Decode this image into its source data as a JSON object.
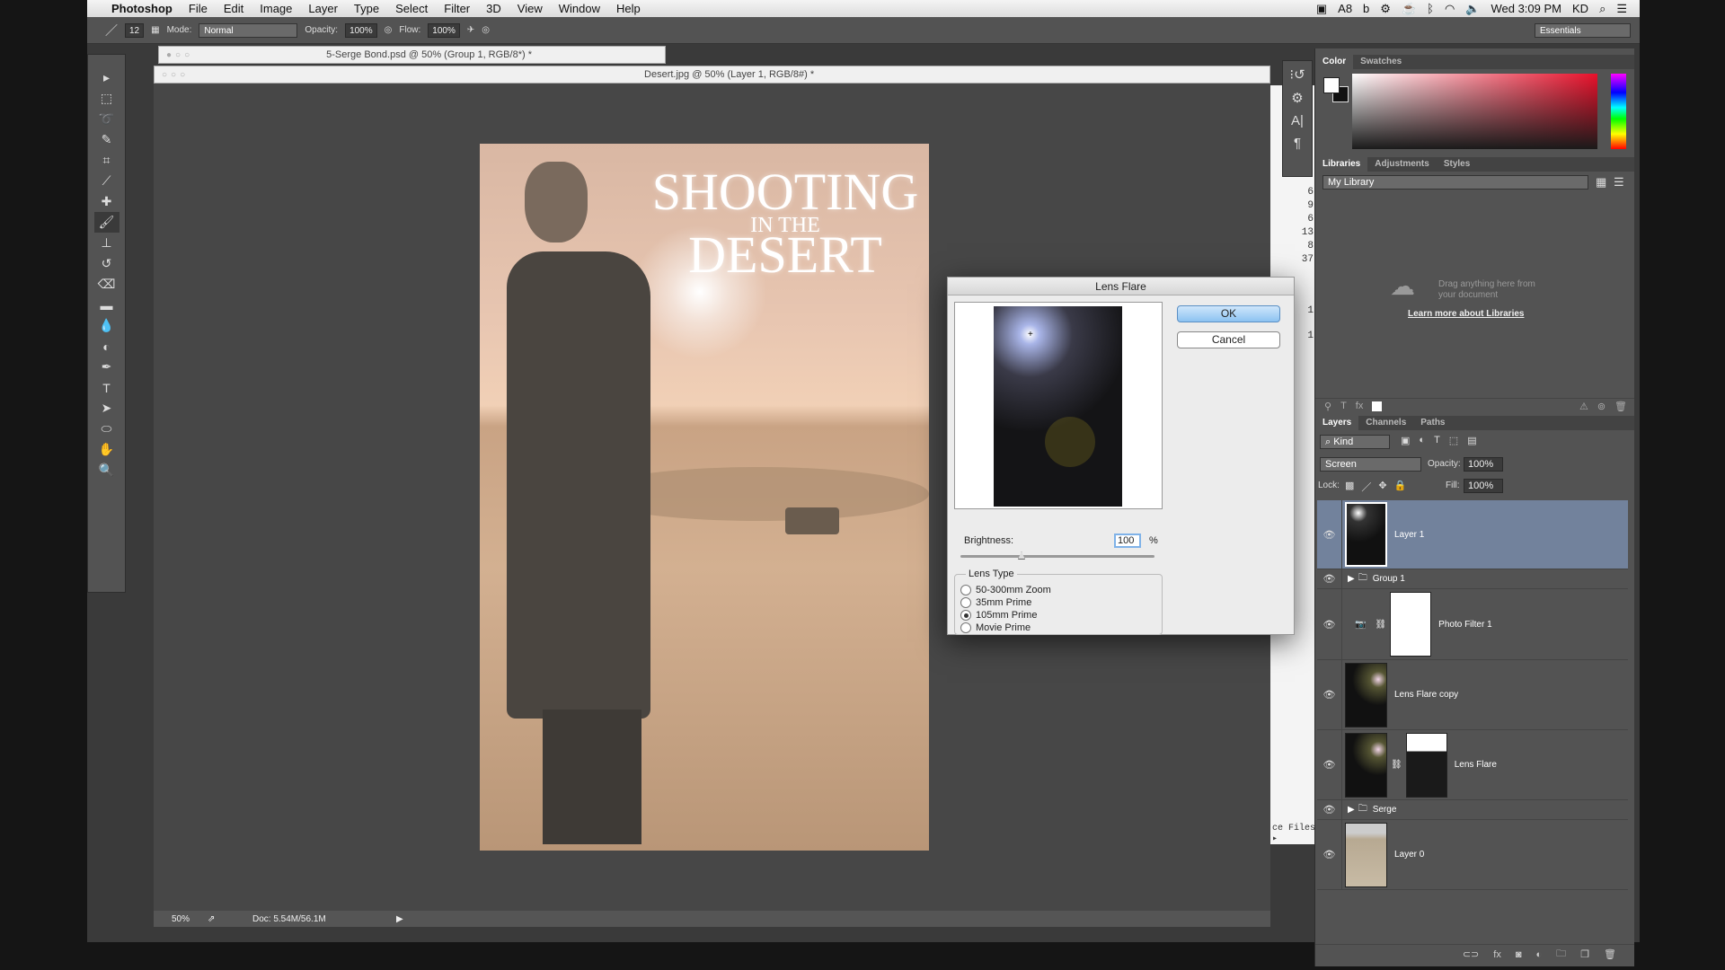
{
  "menubar": {
    "app": "Photoshop",
    "items": [
      "File",
      "Edit",
      "Image",
      "Layer",
      "Type",
      "Select",
      "Filter",
      "3D",
      "View",
      "Window",
      "Help"
    ],
    "status_icons": [
      "camera-icon",
      "adobe-icon",
      "b-icon",
      "gear-icon",
      "satellite-icon",
      "coffee-icon",
      "bluetooth-icon",
      "wifi-icon",
      "volume-icon"
    ],
    "adobe_count": "8",
    "b_label": "b",
    "clock": "Wed 3:09 PM",
    "user": "KD"
  },
  "options": {
    "brush_size": "12",
    "mode_label": "Mode:",
    "mode_value": "Normal",
    "opacity_label": "Opacity:",
    "opacity_value": "100%",
    "flow_label": "Flow:",
    "flow_value": "100%",
    "workspace": "Essentials"
  },
  "tools": [
    "move",
    "marquee",
    "lasso",
    "quick-select",
    "crop",
    "eyedropper",
    "healing",
    "brush",
    "clone-stamp",
    "history-brush",
    "eraser",
    "gradient",
    "blur",
    "dodge",
    "pen",
    "type",
    "path-select",
    "shape",
    "hand",
    "zoom"
  ],
  "tool_glyphs": [
    "▸",
    "⬚",
    "➰",
    "✎",
    "⌗",
    "⟋",
    "✚",
    "🖌",
    "⊥",
    "↺",
    "⌫",
    "▬",
    "💧",
    "◐",
    "✒",
    "T",
    "➤",
    "⬭",
    "✋",
    "🔍"
  ],
  "docs": {
    "tab1": "5-Serge Bond.psd @ 50% (Group 1, RGB/8*) *",
    "tab2": "Desert.jpg @ 50% (Layer 1, RGB/8#) *"
  },
  "poster": {
    "line1": "SHOOTING",
    "line2": "IN THE",
    "line3": "DESERT"
  },
  "status": {
    "zoom": "50%",
    "doc": "Doc: 5.54M/56.1M"
  },
  "dialog": {
    "title": "Lens Flare",
    "ok": "OK",
    "cancel": "Cancel",
    "brightness_label": "Brightness:",
    "brightness_value": "100",
    "brightness_unit": "%",
    "lens_type_label": "Lens Type",
    "lens_types": [
      "50-300mm Zoom",
      "35mm Prime",
      "105mm Prime",
      "Movie Prime"
    ],
    "selected_lens": "105mm Prime"
  },
  "hidden_window": {
    "numbers": [
      "6",
      "9",
      "6",
      "13",
      "8",
      "37",
      "1",
      "1"
    ],
    "footer": "ce Files ▸"
  },
  "color_panel": {
    "tabs": [
      "Color",
      "Swatches"
    ],
    "active": "Color",
    "hue_color": "#e8102a"
  },
  "libraries": {
    "tabs": [
      "Libraries",
      "Adjustments",
      "Styles"
    ],
    "active": "Libraries",
    "library": "My Library",
    "empty_line1": "Drag anything here from",
    "empty_line2": "your document",
    "learn_link": "Learn more about Libraries"
  },
  "layers_panel": {
    "tabs": [
      "Layers",
      "Channels",
      "Paths"
    ],
    "active": "Layers",
    "filter": "Kind",
    "blend_mode": "Screen",
    "opacity_label": "Opacity:",
    "opacity": "100%",
    "lock_label": "Lock:",
    "fill_label": "Fill:",
    "fill": "100%",
    "layers": [
      {
        "name": "Layer 1",
        "selected": true
      },
      {
        "name": "Group 1",
        "group": true
      },
      {
        "name": "Photo Filter 1"
      },
      {
        "name": "Lens Flare copy"
      },
      {
        "name": "Lens Flare"
      },
      {
        "name": "Serge",
        "group": true
      },
      {
        "name": "Layer 0"
      }
    ],
    "selected_color": "#72829c"
  }
}
